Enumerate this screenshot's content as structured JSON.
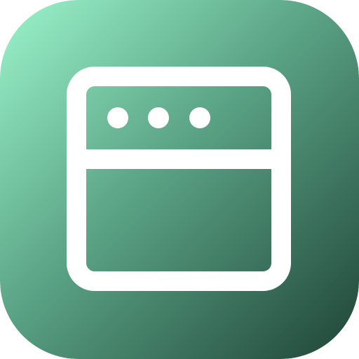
{
  "icon": {
    "name": "browser-window-icon",
    "colors": {
      "gradient_start": "#9BF4CB",
      "gradient_end": "#1F4437",
      "glyph": "#FFFFFF"
    }
  }
}
